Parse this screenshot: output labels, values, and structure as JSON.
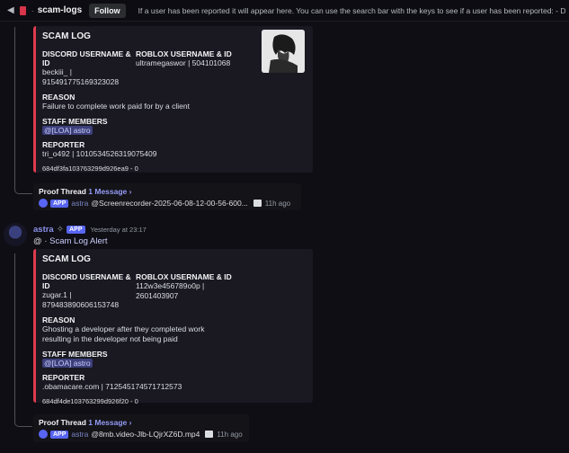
{
  "header": {
    "channel_name": "scam-logs",
    "follow_label": "Follow",
    "topic": "If a user has been reported it will appear here. You can use the search bar with the keys to see if a user has been reported: - D"
  },
  "logs": [
    {
      "title": "SCAM LOG",
      "discord_label": "DISCORD USERNAME & ID",
      "discord_value_1": "beckiii_ |",
      "discord_value_2": "915491775169323028",
      "roblox_label": "ROBLOX USERNAME & ID",
      "roblox_value_1": "ultramegaswor | 504101068",
      "roblox_value_2": "",
      "reason_label": "REASON",
      "reason_1": "Failure to complete work paid for by a client",
      "reason_2": "",
      "staff_label": "STAFF MEMBERS",
      "staff_mention": "@[LOA] astro",
      "reporter_label": "REPORTER",
      "reporter_value": "tri_o492 | 1010534526319075409",
      "footer": "684df3fa103763299d926ea9 - 0",
      "thread": {
        "title": "Proof Thread",
        "count": "1 Message ›",
        "app": "APP",
        "author": "astra",
        "attachment": "@Screenrecorder-2025-06-08-12-00-56-600...",
        "ago": "11h ago"
      }
    },
    {
      "title": "SCAM LOG",
      "discord_label": "DISCORD USERNAME & ID",
      "discord_value_1": "zugar.1 |",
      "discord_value_2": "879483890606153748",
      "roblox_label": "ROBLOX USERNAME & ID",
      "roblox_value_1": "112w3e456789o0p |",
      "roblox_value_2": "2601403907",
      "reason_label": "REASON",
      "reason_1": "Ghosting a developer after they completed work",
      "reason_2": "resulting in the developer not being paid",
      "staff_label": "STAFF MEMBERS",
      "staff_mention": "@[LOA] astro",
      "reporter_label": "REPORTER",
      "reporter_value": ".obamacare.com | 712545174571712573",
      "footer": "684df4de103763299d926f20 - 0",
      "thread": {
        "title": "Proof Thread",
        "count": "1 Message ›",
        "app": "APP",
        "author": "astra",
        "attachment": "@8mb.video-Jlb-LQjrXZ6D.mp4",
        "ago": "11h ago"
      }
    }
  ],
  "message": {
    "author": "astra",
    "app_badge": "APP",
    "timestamp": "Yesterday at 23:17",
    "alert_prefix": "@",
    "alert_text": "Scam Log Alert"
  }
}
